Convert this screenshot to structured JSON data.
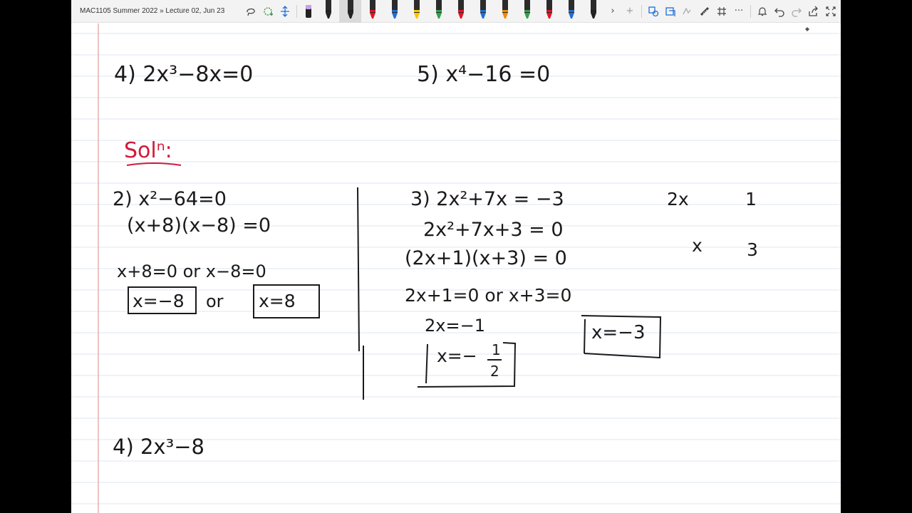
{
  "toolbar": {
    "title": "MAC1105 Summer 2022 » Lecture 02, Jun 23",
    "icons": [
      "lasso-icon",
      "add-space-icon",
      "move-icon",
      "eraser-icon",
      "pen-icon"
    ],
    "pens": [
      "#222222",
      "#222222",
      "#e81123",
      "#1e6fd9",
      "#f7c600",
      "#2fa34a",
      "#e81123",
      "#1e6fd9",
      "#f08a00",
      "#2fa34a",
      "#e81123",
      "#1e6fd9",
      "#222222"
    ],
    "more_chevron": "›",
    "add_pen": "+",
    "more_menu": "···"
  },
  "notes": {
    "p4_top": "4) 2x³−8x=0",
    "p5_top": "5) x⁴−16 =0",
    "soln": "Solⁿ:",
    "p2": {
      "l1": "2) x²−64=0",
      "l2": "(x+8)(x−8) =0",
      "l3": "x+8=0 or x−8=0",
      "a1": "x=−8",
      "or": "or",
      "a2": "x=8"
    },
    "p3": {
      "l1": "3) 2x²+7x = −3",
      "l2": "2x²+7x+3 = 0",
      "l3": "(2x+1)(x+3) = 0",
      "l4": "2x+1=0 or x+3=0",
      "l5": "2x=−1",
      "a1_left": "x=−",
      "a1_num": "1",
      "a1_den": "2",
      "a2": "x=−3",
      "grid_a": "2x",
      "grid_b": "1",
      "grid_c": "x",
      "grid_d": "3"
    },
    "p4_bottom": "4) 2x³−8"
  },
  "colors": {
    "ink": "#1a1a1a",
    "red": "#d11a3a",
    "margin": "#e8a8a8",
    "rule": "#dde7f2"
  }
}
